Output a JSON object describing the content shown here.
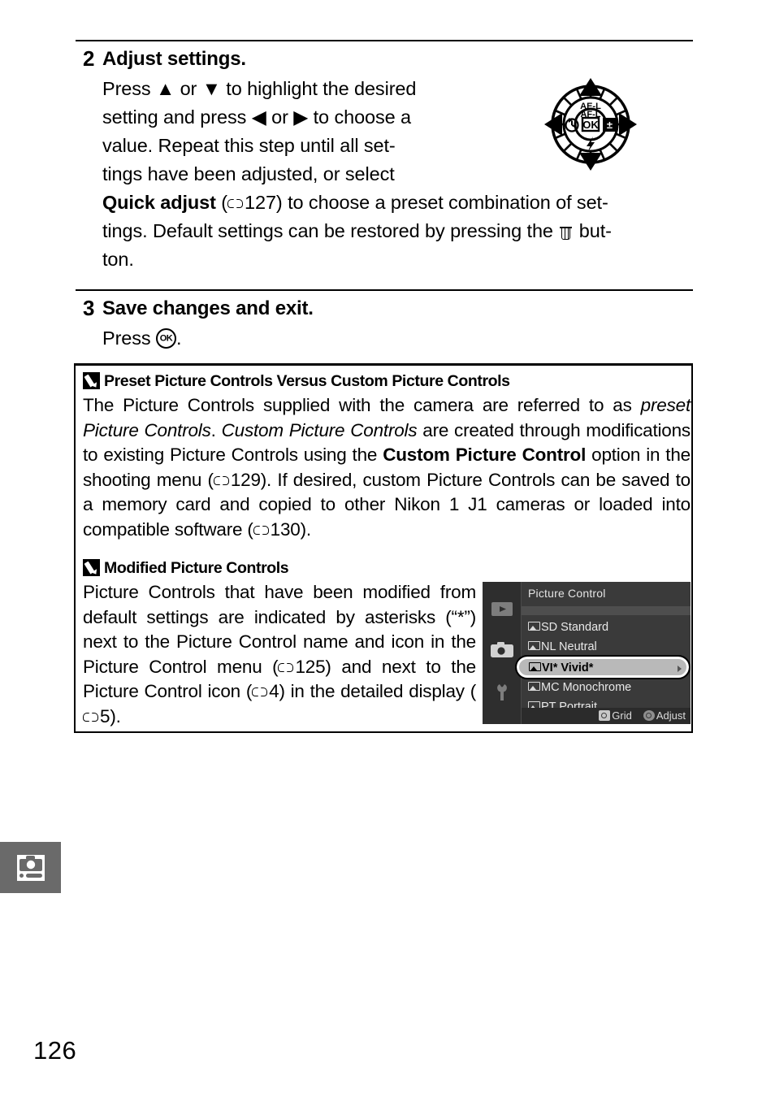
{
  "page": {
    "number": "126",
    "side_tab_icon": "shooting-menu-camera-icon"
  },
  "steps": [
    {
      "number": "2",
      "title": "Adjust settings.",
      "lines": [
        "Press ▲ or ▼ to highlight the desired",
        "setting and press ◀ or ▶ to choose a",
        "value. Repeat this step until all set-",
        "tings have been adjusted, or select"
      ],
      "bold_lead": "Quick adjust",
      "ref_page": "127",
      "tail_line_1": " to choose a preset combination of set-",
      "tail_line_2_a": "tings. Default settings can be restored by pressing the ",
      "tail_line_2_b": " but-",
      "tail_line_3": "ton."
    },
    {
      "number": "3",
      "title": "Save changes and exit.",
      "press_label": "Press ",
      "press_suffix": "."
    }
  ],
  "multi_selector": {
    "top_label_line1": "AE-L",
    "top_label_line2": "AF-L",
    "center_label": "OK",
    "left_icon": "self-timer-icon",
    "right_icon": "exposure-compensation-icon",
    "bottom_icon": "flash-icon"
  },
  "notes": [
    {
      "icon": "pencil-note-icon",
      "heading": "Preset Picture Controls Versus Custom Picture Controls",
      "body_parts": [
        {
          "t": "The Picture Controls supplied with the camera are referred to as ",
          "s": "normal"
        },
        {
          "t": "preset Picture Controls",
          "s": "italic"
        },
        {
          "t": ". ",
          "s": "normal"
        },
        {
          "t": "Custom Picture Controls",
          "s": "italic"
        },
        {
          "t": " are created through modifications to existing Picture Controls using the ",
          "s": "normal"
        },
        {
          "t": "Custom Picture Control",
          "s": "bold"
        },
        {
          "t": " option in the shooting menu (",
          "s": "normal"
        },
        {
          "t": "129",
          "s": "ref"
        },
        {
          "t": "). If desired, custom Picture Controls can be saved to a memory card and copied to other Nikon 1 J1 cameras or loaded into compatible software (",
          "s": "normal"
        },
        {
          "t": "130",
          "s": "ref"
        },
        {
          "t": ").",
          "s": "normal"
        }
      ]
    },
    {
      "icon": "pencil-note-icon",
      "heading": "Modified Picture Controls",
      "body_parts": [
        {
          "t": "Picture Controls that have been modified from default settings are indicated by asterisks (“*”) next to the Picture Control name and icon in the Picture Control menu (",
          "s": "normal"
        },
        {
          "t": "125",
          "s": "ref"
        },
        {
          "t": ") and next to the Picture Control icon (",
          "s": "normal"
        },
        {
          "t": "4",
          "s": "ref"
        },
        {
          "t": ") in the detailed display (",
          "s": "normal"
        },
        {
          "t": "5",
          "s": "ref"
        },
        {
          "t": ").",
          "s": "normal"
        }
      ]
    }
  ],
  "lcd": {
    "title": "Picture Control",
    "sidebar_icons": [
      "playback-icon",
      "shooting-menu-icon",
      "setup-menu-icon"
    ],
    "selected_sidebar": "shooting-menu-icon",
    "items": [
      {
        "code": "SD",
        "label": "Standard",
        "selected": false
      },
      {
        "code": "NL",
        "label": "Neutral",
        "selected": false
      },
      {
        "code": "VI*",
        "label": "Vivid*",
        "selected": true
      },
      {
        "code": "MC",
        "label": "Monochrome",
        "selected": false
      },
      {
        "code": "PT",
        "label": "Portrait",
        "selected": false
      }
    ],
    "footer": {
      "grid_label": "Grid",
      "adjust_label": "Adjust"
    }
  }
}
